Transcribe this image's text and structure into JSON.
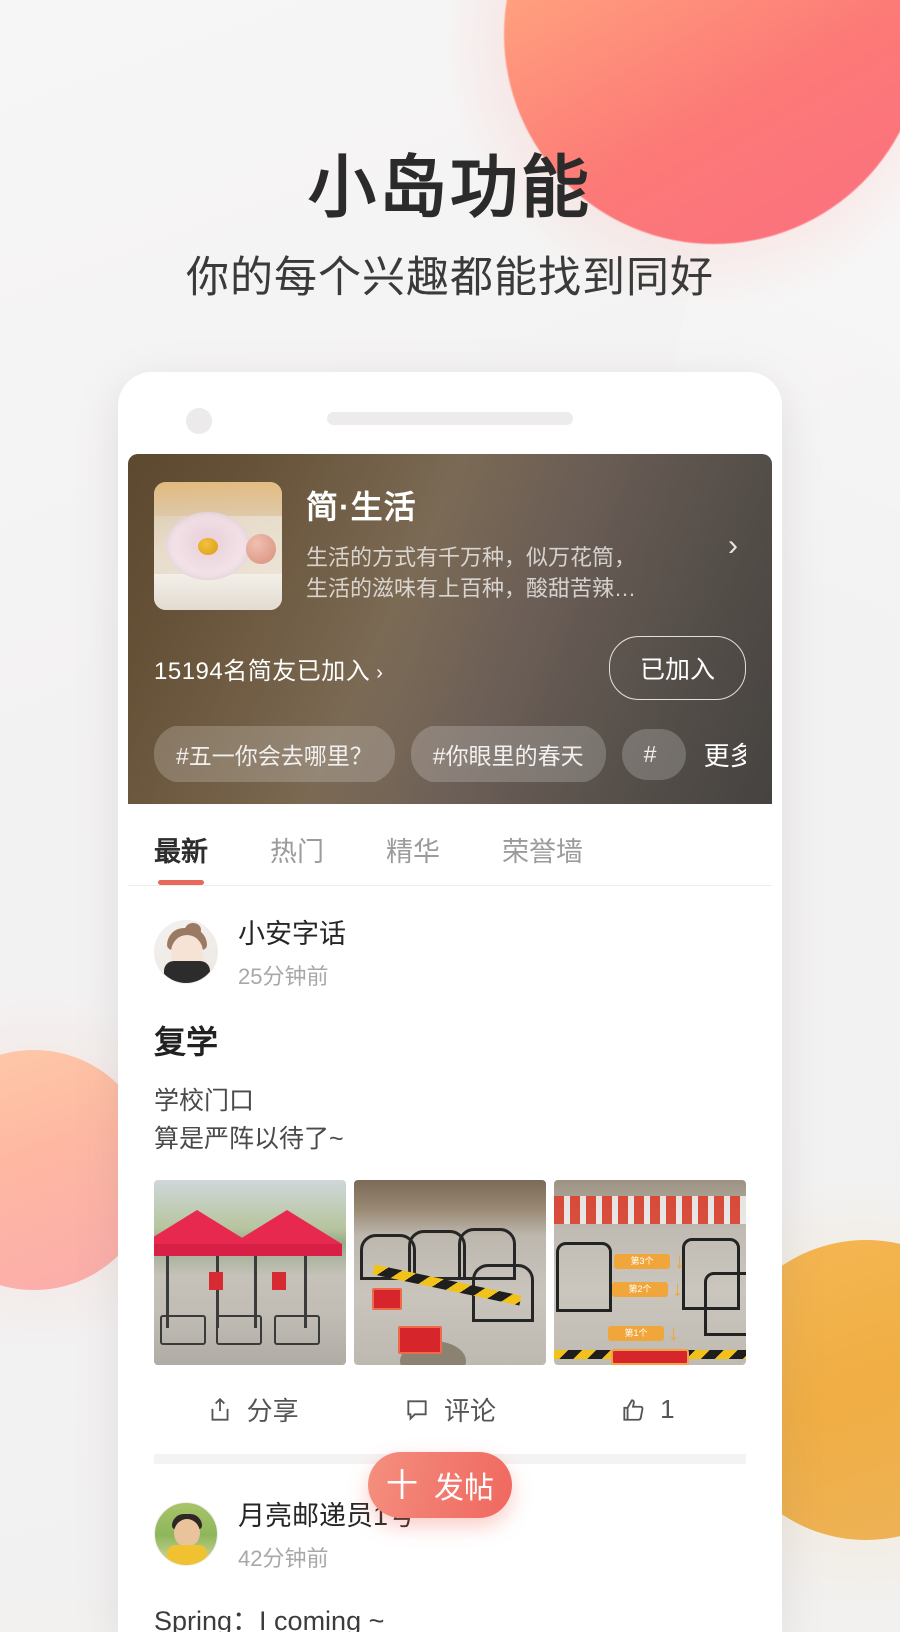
{
  "hero": {
    "title": "小岛功能",
    "subtitle": "你的每个兴趣都能找到同好"
  },
  "group": {
    "name": "简·生活",
    "description": "生活的方式有千万种，似万花筒，\n生活的滋味有上百种，酸甜苦辣…",
    "chevron": "›",
    "member_count_text": "15194名简友已加入",
    "member_arrow": "›",
    "join_button": "已加入",
    "topics": [
      "#五一你会去哪里？",
      "#你眼里的春天",
      "#"
    ],
    "more_label": "更多"
  },
  "tabs": [
    {
      "label": "最新",
      "active": true
    },
    {
      "label": "热门",
      "active": false
    },
    {
      "label": "精华",
      "active": false
    },
    {
      "label": "荣誉墙",
      "active": false
    }
  ],
  "posts": [
    {
      "author": "小安字话",
      "time": "25分钟前",
      "title": "复学",
      "body": "学校门口\n算是严阵以待了~",
      "photo_signs": [
        "第3个",
        "第2个",
        "第1个"
      ],
      "actions": {
        "share_label": "分享",
        "comment_label": "评论",
        "like_count": "1"
      }
    },
    {
      "author": "月亮邮递员1号",
      "time": "42分钟前",
      "body": "Spring：I coming ~"
    }
  ],
  "fab": {
    "plus": "十",
    "label": "发帖"
  },
  "colors": {
    "accent": "#e8685a",
    "fab": "#f27e72",
    "hero_blob": "#fc7a77",
    "bottom_left_blob": "#ffb49d",
    "bottom_right_blob": "#f0ab3c"
  }
}
